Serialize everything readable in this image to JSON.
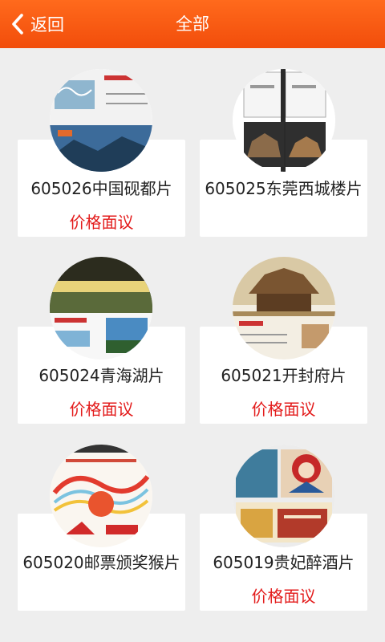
{
  "header": {
    "back_label": "返回",
    "title": "全部",
    "bar_color": "#f45410"
  },
  "items": [
    {
      "name": "605026中国砚都片",
      "price": "价格面议"
    },
    {
      "name": "605025东莞西城楼片",
      "price": ""
    },
    {
      "name": "605024青海湖片",
      "price": "价格面议"
    },
    {
      "name": "605021开封府片",
      "price": "价格面议"
    },
    {
      "name": "605020邮票颁奖猴片",
      "price": ""
    },
    {
      "name": "605019贵妃醉酒片",
      "price": "价格面议"
    }
  ],
  "colors": {
    "price": "#e31b1b",
    "background": "#eeeeee"
  }
}
